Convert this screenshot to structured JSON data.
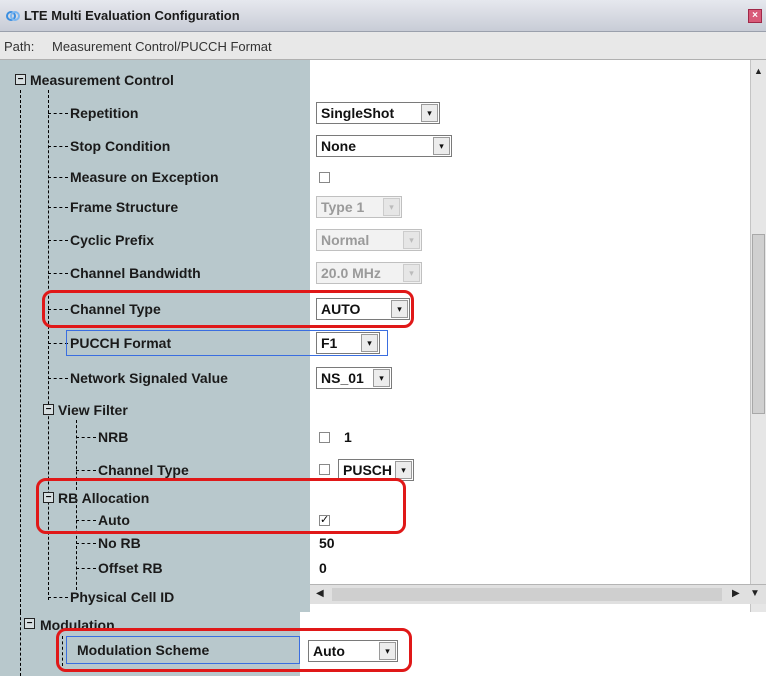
{
  "window": {
    "title": "LTE Multi Evaluation Configuration",
    "close_glyph": "×"
  },
  "path": {
    "label": "Path:",
    "value": "Measurement Control/PUCCH Format"
  },
  "tree": {
    "root": {
      "label": "Measurement Control",
      "expander": "−"
    },
    "items": {
      "repetition": {
        "label": "Repetition",
        "value": "SingleShot"
      },
      "stop_condition": {
        "label": "Stop Condition",
        "value": "None"
      },
      "measure_on_exception": {
        "label": "Measure on Exception",
        "checked": false
      },
      "frame_structure": {
        "label": "Frame Structure",
        "value": "Type 1"
      },
      "cyclic_prefix": {
        "label": "Cyclic Prefix",
        "value": "Normal"
      },
      "channel_bandwidth": {
        "label": "Channel Bandwidth",
        "value": "20.0 MHz"
      },
      "channel_type": {
        "label": "Channel Type",
        "value": "AUTO"
      },
      "pucch_format": {
        "label": "PUCCH Format",
        "value": "F1"
      },
      "network_signaled_value": {
        "label": "Network Signaled Value",
        "value": "NS_01"
      },
      "view_filter": {
        "label": "View Filter",
        "expander": "−",
        "nrb": {
          "label": "NRB",
          "checked": false,
          "value": "1"
        },
        "channel_type": {
          "label": "Channel Type",
          "checked": false,
          "value": "PUSCH"
        }
      },
      "rb_allocation": {
        "label": "RB Allocation",
        "expander": "−",
        "auto": {
          "label": "Auto",
          "checked": true
        },
        "no_rb": {
          "label": "No RB",
          "value": "50"
        },
        "offset_rb": {
          "label": "Offset RB",
          "value": "0"
        }
      },
      "physical_cell_id": {
        "label": "Physical Cell ID"
      }
    },
    "modulation": {
      "label": "Modulation",
      "expander": "−",
      "scheme": {
        "label": "Modulation Scheme",
        "value": "Auto"
      }
    }
  },
  "icons": {
    "dropdown_arrow": "▾",
    "check_mark": "✓",
    "scroll_up": "▲",
    "scroll_left": "◀",
    "scroll_right": "▶",
    "scroll_down": "▼"
  },
  "colors": {
    "highlight_red": "#e01818",
    "selection_blue": "#3a6ee0",
    "tree_bg": "#b8c8cc"
  }
}
